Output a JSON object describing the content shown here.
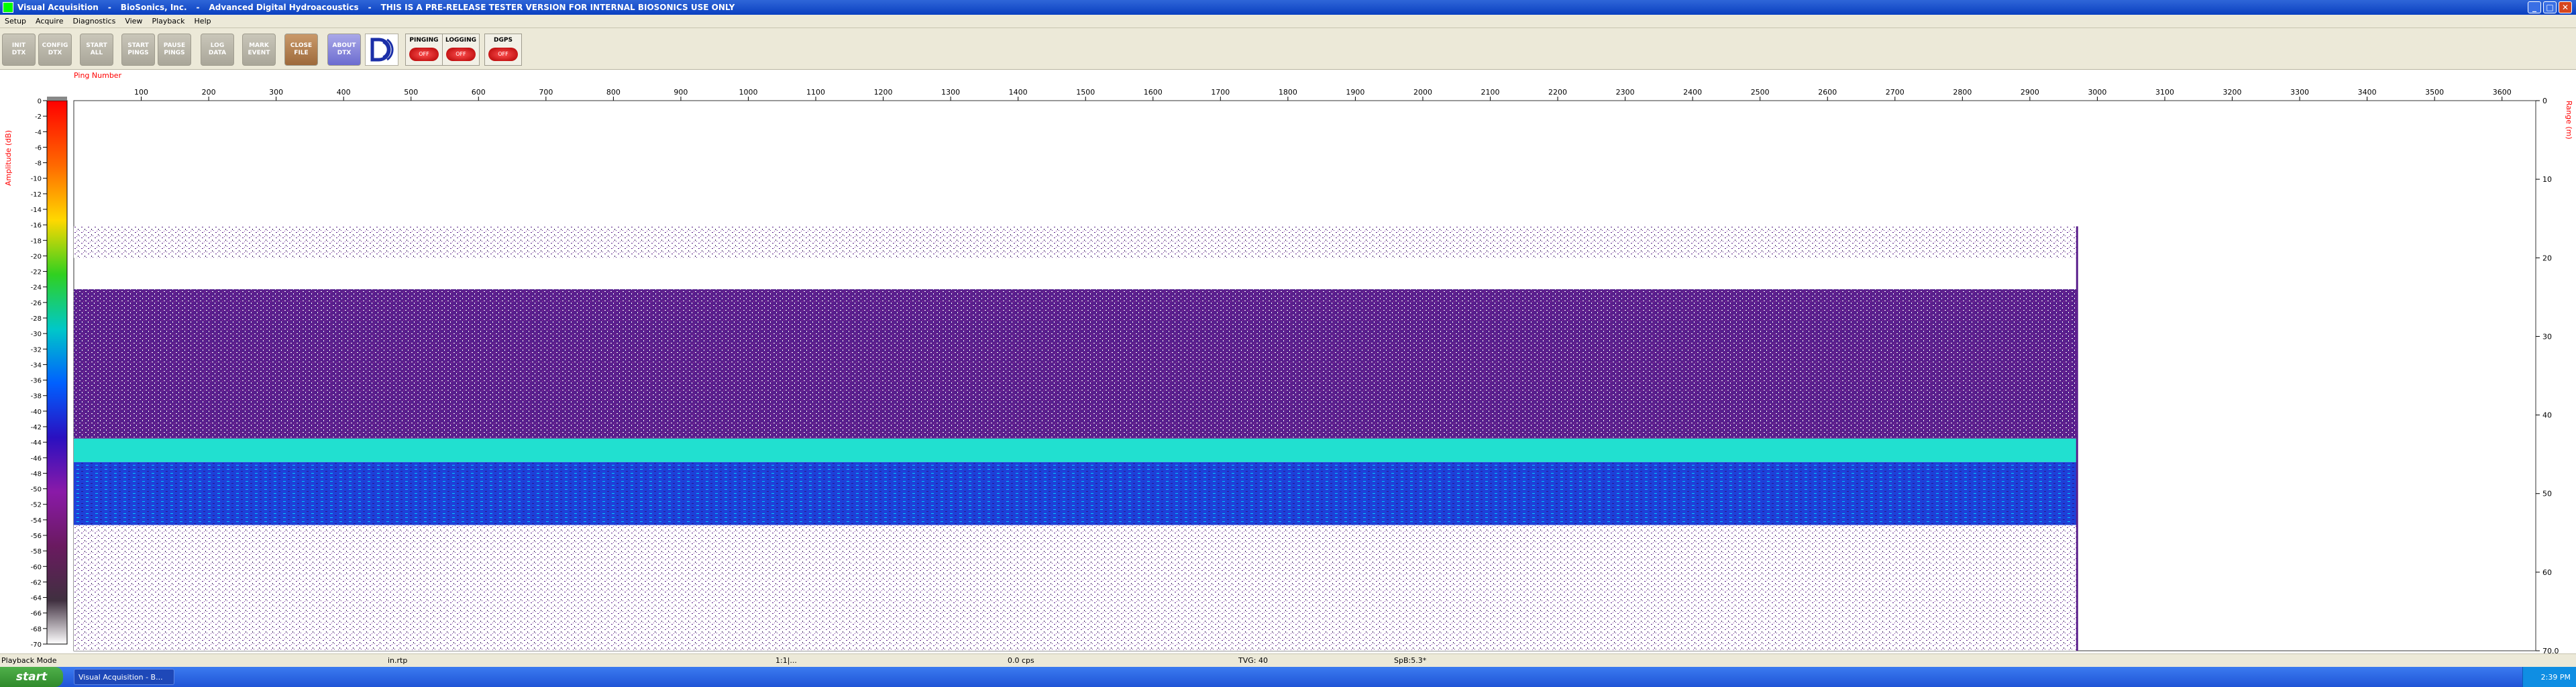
{
  "window": {
    "title_parts": [
      "Visual Acquisition",
      "BioSonics, Inc.",
      "Advanced Digital Hydroacoustics",
      "THIS IS A PRE-RELEASE TESTER VERSION FOR INTERNAL BIOSONICS USE ONLY"
    ],
    "minimize": "_",
    "maximize": "□",
    "close": "✕"
  },
  "menu": [
    "Setup",
    "Acquire",
    "Diagnostics",
    "View",
    "Playback",
    "Help"
  ],
  "toolbar": {
    "buttons": [
      {
        "line1": "INIT",
        "line2": "DTX"
      },
      {
        "line1": "CONFIG",
        "line2": "DTX"
      },
      {
        "line1": "START",
        "line2": "ALL"
      },
      {
        "line1": "START",
        "line2": "PINGS"
      },
      {
        "line1": "PAUSE",
        "line2": "PINGS"
      },
      {
        "line1": "LOG",
        "line2": "DATA"
      },
      {
        "line1": "MARK",
        "line2": "EVENT"
      },
      {
        "line1": "CLOSE",
        "line2": "FILE"
      },
      {
        "line1": "ABOUT",
        "line2": "DTX"
      }
    ],
    "status": [
      {
        "label": "PINGING",
        "state": "OFF"
      },
      {
        "label": "LOGGING",
        "state": "OFF"
      },
      {
        "label": "DGPS",
        "state": "OFF"
      }
    ]
  },
  "chart_data": {
    "type": "heatmap",
    "title": "Ping Number",
    "x_ticks": [
      100,
      200,
      300,
      400,
      500,
      600,
      700,
      800,
      900,
      1000,
      1100,
      1200,
      1300,
      1400,
      1500,
      1600,
      1700,
      1800,
      1900,
      2000,
      2100,
      2200,
      2300,
      2400,
      2500,
      2600,
      2700,
      2800,
      2900,
      3000,
      3100,
      3200,
      3300,
      3400,
      3500,
      3600
    ],
    "xlim": [
      0,
      3650
    ],
    "data_extent_pings": [
      0,
      2970
    ],
    "colorbar": {
      "label": "Amplitude (dB)",
      "ticks": [
        "0",
        "-2",
        "-4",
        "-6",
        "-8",
        "-10",
        "-12",
        "-14",
        "-16",
        "-18",
        "-20",
        "-22",
        "-24",
        "-26",
        "-28",
        "-30",
        "-32",
        "-34",
        "-36",
        "-38",
        "-40",
        "-42",
        "-44",
        "-46",
        "-48",
        "-50",
        "-52",
        "-54",
        "-56",
        "-58",
        "-60",
        "-62",
        "-64",
        "-66",
        "-68",
        "-70"
      ]
    },
    "range_axis": {
      "label": "Range (m)",
      "ticks": [
        "0",
        "10",
        "20",
        "30",
        "40",
        "50",
        "60",
        "70.0"
      ],
      "ylim": [
        0,
        70
      ]
    },
    "bands": [
      {
        "name": "surface-noise",
        "range_m": [
          16,
          20
        ],
        "level": "low"
      },
      {
        "name": "purple-scatter",
        "range_m": [
          24,
          43
        ],
        "level": "medium"
      },
      {
        "name": "cyan-layer",
        "range_m": [
          43,
          46
        ],
        "level": "high"
      },
      {
        "name": "blue-layer",
        "range_m": [
          46,
          54
        ],
        "level": "high"
      },
      {
        "name": "lower-scatter",
        "range_m": [
          54,
          70
        ],
        "level": "low"
      }
    ]
  },
  "statusbar": {
    "mode": "Playback Mode",
    "fields": [
      "in.rtp",
      "1:1|...",
      "0.0 cps",
      "TVG: 40",
      "SpB:5.3*"
    ]
  },
  "taskbar": {
    "start": "start",
    "item": "Visual Acquisition - B...",
    "time": "2:39 PM"
  }
}
